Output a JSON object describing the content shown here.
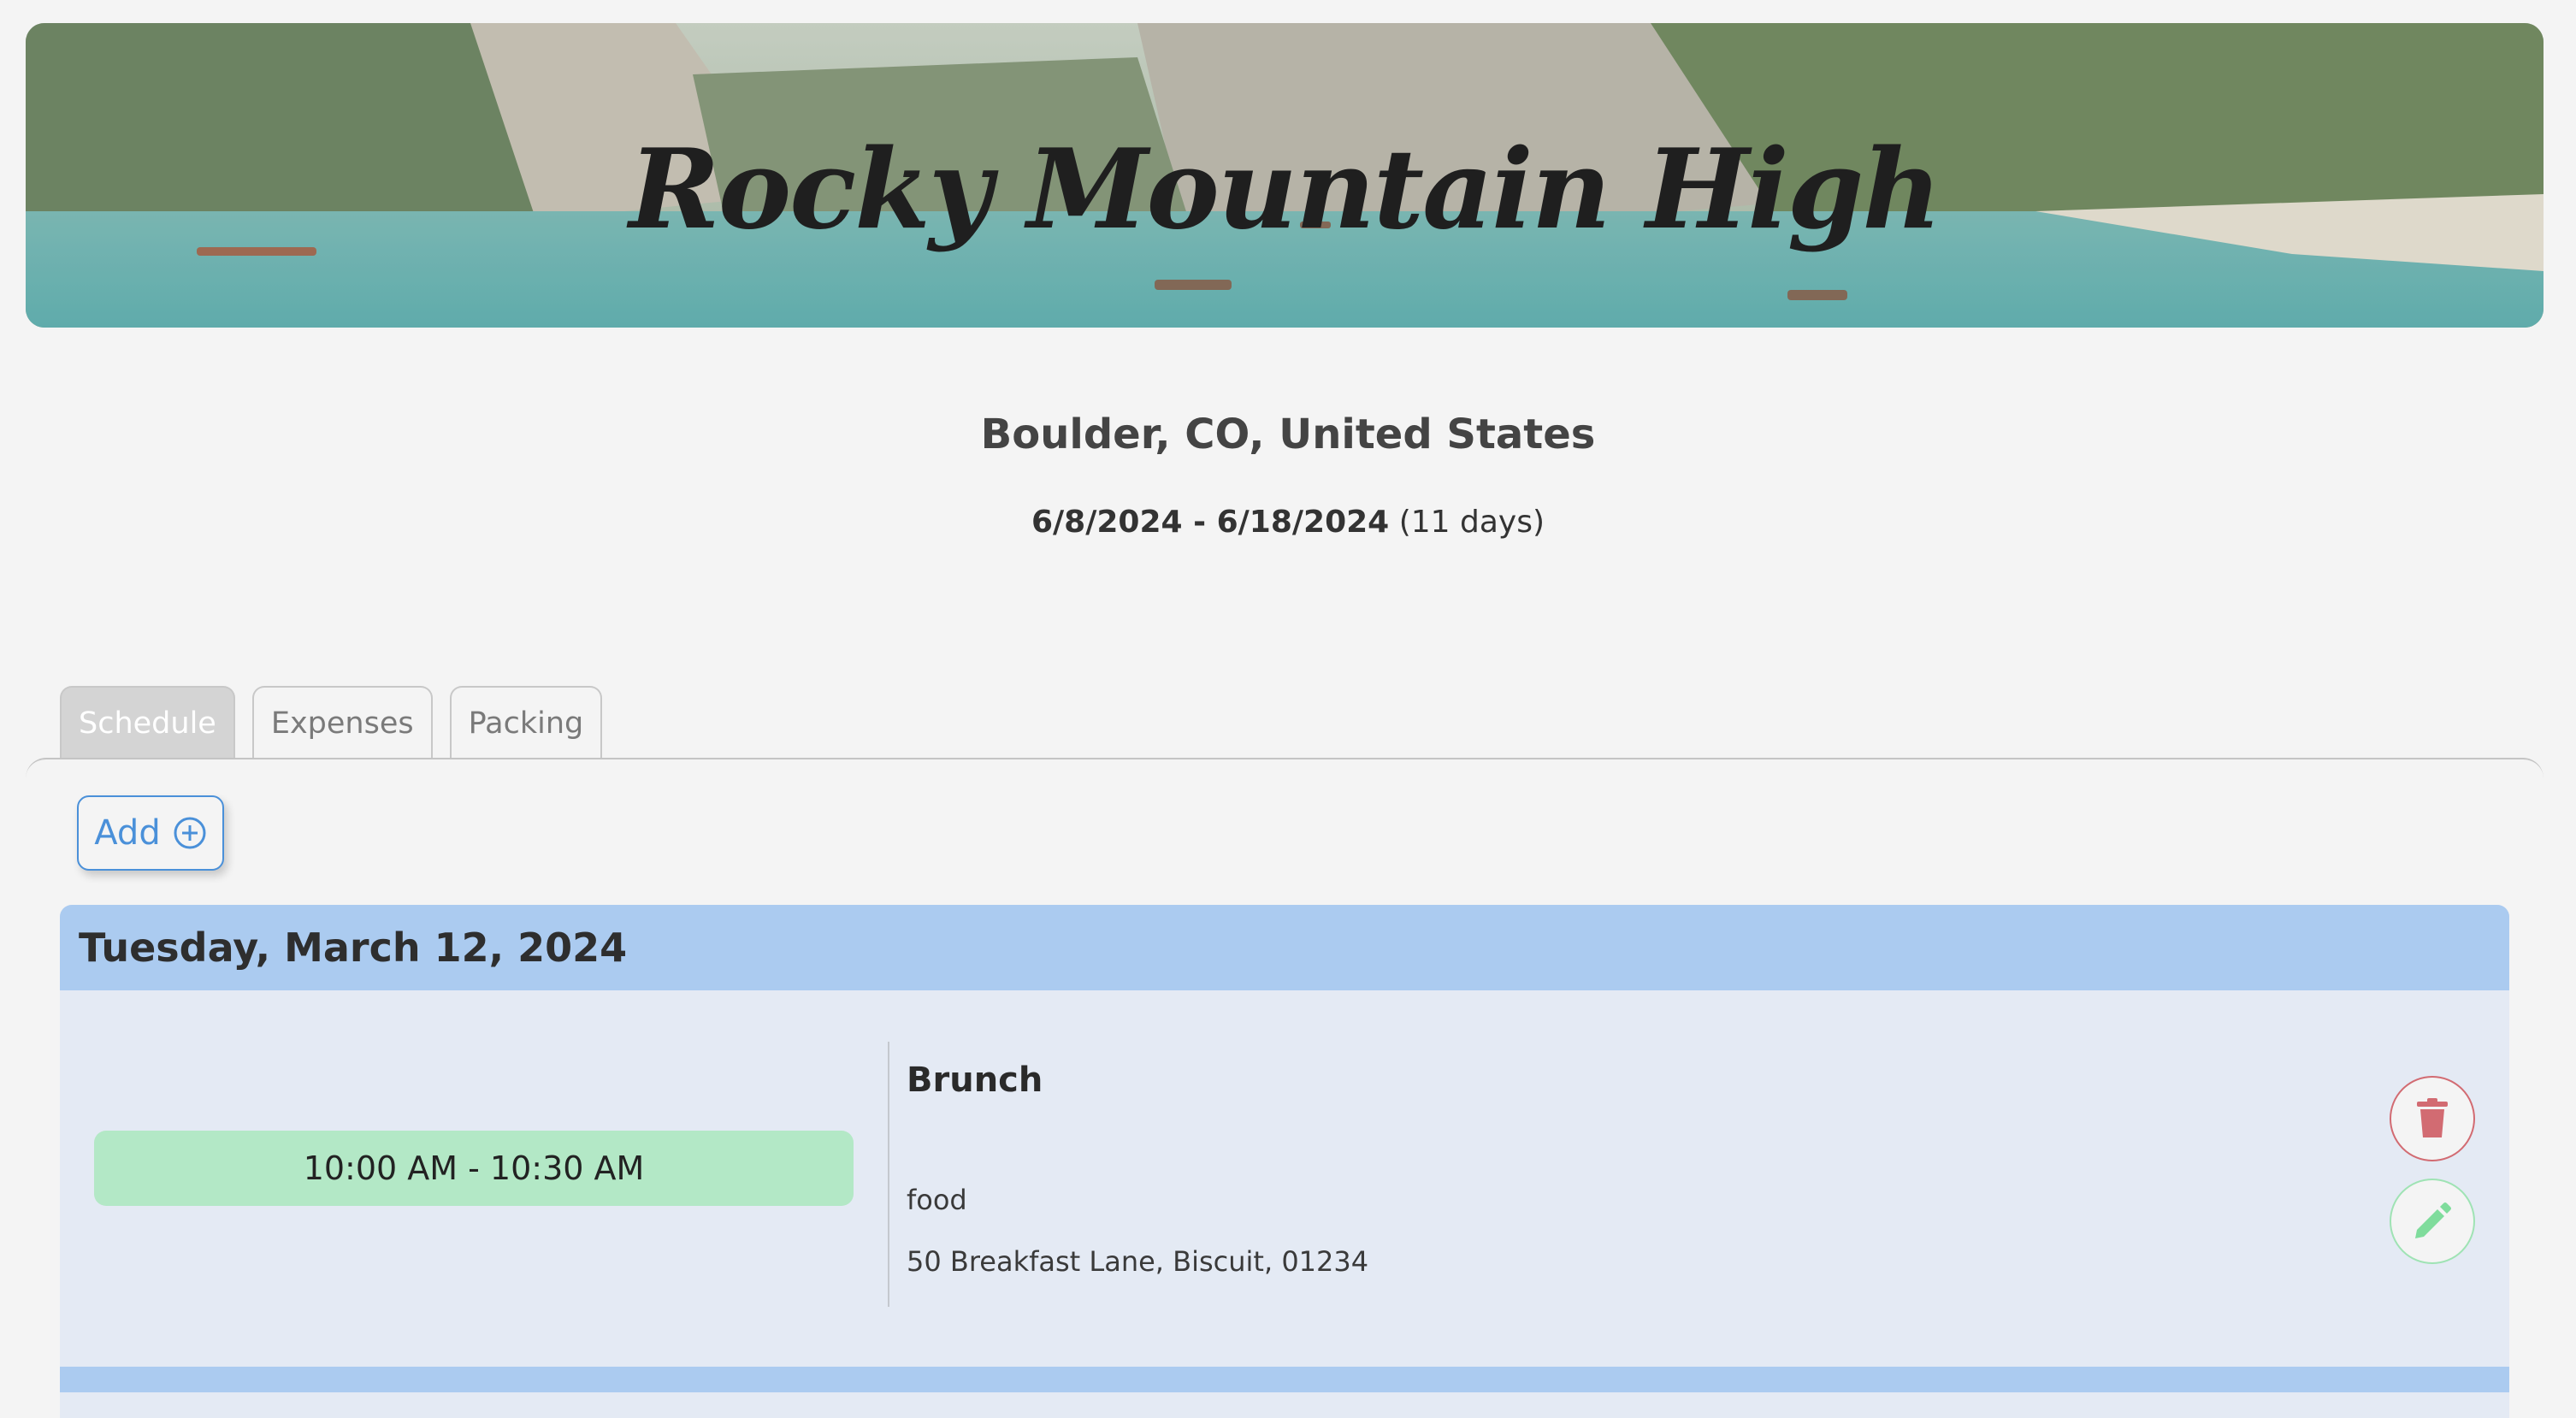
{
  "banner": {
    "title": "Rocky Mountain High"
  },
  "trip": {
    "location": "Boulder, CO, United States",
    "date_range": "6/8/2024 - 6/18/2024",
    "duration": "(11 days)"
  },
  "tabs": [
    {
      "label": "Schedule",
      "active": true
    },
    {
      "label": "Expenses",
      "active": false
    },
    {
      "label": "Packing",
      "active": false
    }
  ],
  "toolbar": {
    "add_label": "Add",
    "add_icon": "plus-circle-icon"
  },
  "schedule": {
    "days": [
      {
        "date_label": "Tuesday, March 12, 2024",
        "events": [
          {
            "time": "10:00 AM - 10:30 AM",
            "title": "Brunch",
            "category": "food",
            "address": "50 Breakfast Lane, Biscuit, 01234",
            "delete_icon": "trash-icon",
            "edit_icon": "pencil-icon"
          }
        ]
      }
    ]
  },
  "colors": {
    "accent_blue": "#4a90d9",
    "day_header": "#abcbf0",
    "time_pill": "#b3e8c6",
    "delete_red": "#d26b72",
    "edit_green": "#7fdc9c"
  }
}
